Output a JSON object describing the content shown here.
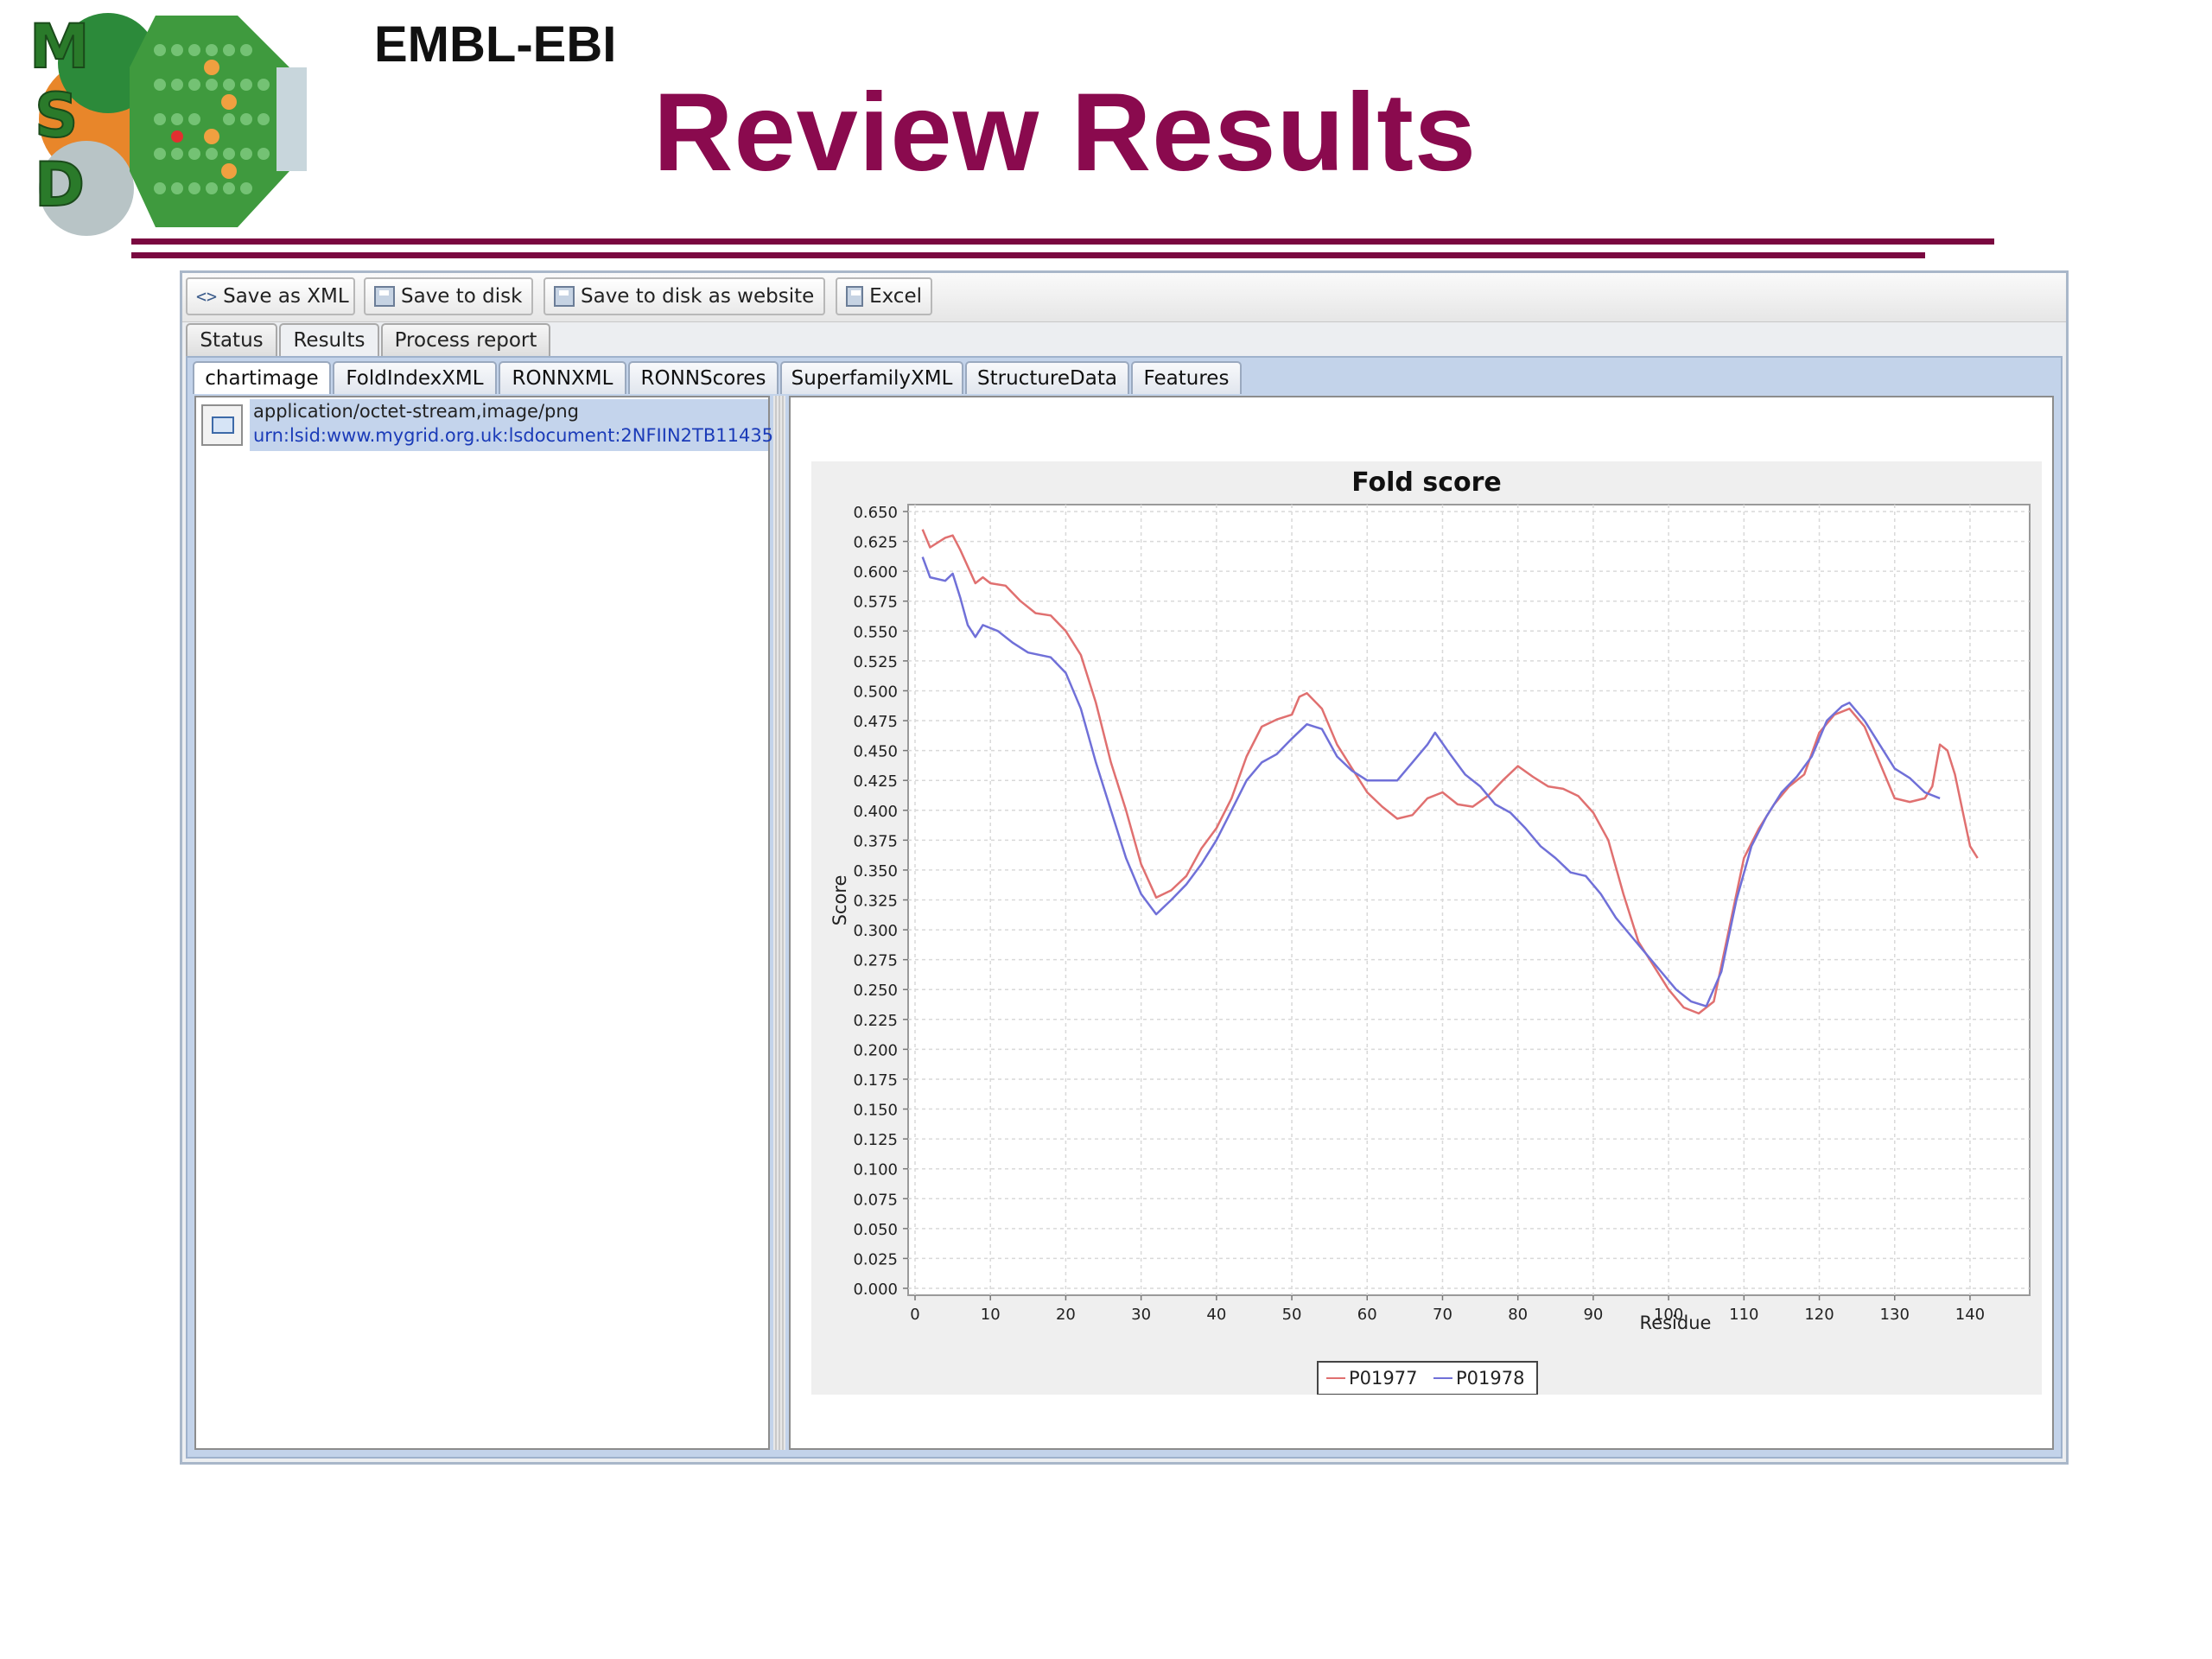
{
  "header": {
    "org": "EMBL-EBI",
    "title": "Review Results",
    "logo_text": "MSD",
    "title_color": "#8a0a4e"
  },
  "toolbar": {
    "save_xml": "Save as XML",
    "save_disk": "Save to disk",
    "save_website": "Save to disk as website",
    "excel": "Excel"
  },
  "tabs": {
    "main": [
      "Status",
      "Results",
      "Process report"
    ],
    "active_main": "Results",
    "sub": [
      "chartimage",
      "FoldIndexXML",
      "RONNXML",
      "RONNScores",
      "SuperfamilyXML",
      "StructureData",
      "Features"
    ],
    "active_sub": "chartimage"
  },
  "result_item": {
    "mime": "application/octet-stream,image/png",
    "urn": "urn:lsid:www.mygrid.org.uk:lsdocument:2NFIIN2TB11435"
  },
  "chart_data": {
    "type": "line",
    "title": "Fold score",
    "xlabel": "Residue",
    "ylabel": "Score",
    "xlim": [
      0,
      147
    ],
    "ylim": [
      0,
      0.65
    ],
    "xticks": [
      0,
      10,
      20,
      30,
      40,
      50,
      60,
      70,
      80,
      90,
      100,
      110,
      120,
      130,
      140
    ],
    "yticks": [
      0.0,
      0.025,
      0.05,
      0.075,
      0.1,
      0.125,
      0.15,
      0.175,
      0.2,
      0.225,
      0.25,
      0.275,
      0.3,
      0.325,
      0.35,
      0.375,
      0.4,
      0.425,
      0.45,
      0.475,
      0.5,
      0.525,
      0.55,
      0.575,
      0.6,
      0.625,
      0.65
    ],
    "grid": true,
    "legend": "bottom-center",
    "series": [
      {
        "name": "P01977",
        "color": "#e07070",
        "points": [
          [
            1,
            0.635
          ],
          [
            2,
            0.62
          ],
          [
            4,
            0.628
          ],
          [
            5,
            0.63
          ],
          [
            6,
            0.618
          ],
          [
            8,
            0.59
          ],
          [
            9,
            0.595
          ],
          [
            10,
            0.59
          ],
          [
            12,
            0.588
          ],
          [
            14,
            0.575
          ],
          [
            16,
            0.565
          ],
          [
            18,
            0.563
          ],
          [
            20,
            0.55
          ],
          [
            22,
            0.53
          ],
          [
            24,
            0.49
          ],
          [
            26,
            0.44
          ],
          [
            28,
            0.4
          ],
          [
            30,
            0.355
          ],
          [
            32,
            0.327
          ],
          [
            34,
            0.333
          ],
          [
            36,
            0.345
          ],
          [
            38,
            0.368
          ],
          [
            40,
            0.385
          ],
          [
            42,
            0.41
          ],
          [
            44,
            0.445
          ],
          [
            46,
            0.47
          ],
          [
            48,
            0.476
          ],
          [
            50,
            0.48
          ],
          [
            51,
            0.495
          ],
          [
            52,
            0.498
          ],
          [
            54,
            0.485
          ],
          [
            56,
            0.455
          ],
          [
            58,
            0.435
          ],
          [
            60,
            0.415
          ],
          [
            62,
            0.403
          ],
          [
            64,
            0.393
          ],
          [
            66,
            0.396
          ],
          [
            68,
            0.41
          ],
          [
            70,
            0.415
          ],
          [
            72,
            0.405
          ],
          [
            74,
            0.403
          ],
          [
            76,
            0.412
          ],
          [
            78,
            0.425
          ],
          [
            80,
            0.437
          ],
          [
            82,
            0.428
          ],
          [
            84,
            0.42
          ],
          [
            86,
            0.418
          ],
          [
            88,
            0.412
          ],
          [
            90,
            0.398
          ],
          [
            92,
            0.375
          ],
          [
            94,
            0.33
          ],
          [
            96,
            0.29
          ],
          [
            98,
            0.27
          ],
          [
            100,
            0.25
          ],
          [
            102,
            0.235
          ],
          [
            104,
            0.23
          ],
          [
            106,
            0.24
          ],
          [
            108,
            0.3
          ],
          [
            110,
            0.36
          ],
          [
            112,
            0.385
          ],
          [
            114,
            0.405
          ],
          [
            116,
            0.42
          ],
          [
            118,
            0.43
          ],
          [
            120,
            0.465
          ],
          [
            122,
            0.48
          ],
          [
            124,
            0.485
          ],
          [
            126,
            0.47
          ],
          [
            128,
            0.44
          ],
          [
            130,
            0.41
          ],
          [
            132,
            0.407
          ],
          [
            134,
            0.41
          ],
          [
            135,
            0.42
          ],
          [
            136,
            0.455
          ],
          [
            137,
            0.45
          ],
          [
            138,
            0.43
          ],
          [
            139,
            0.4
          ],
          [
            140,
            0.37
          ],
          [
            141,
            0.36
          ]
        ]
      },
      {
        "name": "P01978",
        "color": "#7070d8",
        "points": [
          [
            1,
            0.612
          ],
          [
            2,
            0.595
          ],
          [
            4,
            0.592
          ],
          [
            5,
            0.598
          ],
          [
            6,
            0.578
          ],
          [
            7,
            0.555
          ],
          [
            8,
            0.545
          ],
          [
            9,
            0.555
          ],
          [
            11,
            0.55
          ],
          [
            13,
            0.54
          ],
          [
            15,
            0.532
          ],
          [
            18,
            0.528
          ],
          [
            20,
            0.515
          ],
          [
            22,
            0.485
          ],
          [
            24,
            0.44
          ],
          [
            26,
            0.4
          ],
          [
            28,
            0.36
          ],
          [
            30,
            0.33
          ],
          [
            32,
            0.313
          ],
          [
            34,
            0.325
          ],
          [
            36,
            0.338
          ],
          [
            38,
            0.355
          ],
          [
            40,
            0.375
          ],
          [
            42,
            0.4
          ],
          [
            44,
            0.425
          ],
          [
            46,
            0.44
          ],
          [
            48,
            0.447
          ],
          [
            50,
            0.46
          ],
          [
            52,
            0.472
          ],
          [
            54,
            0.468
          ],
          [
            56,
            0.445
          ],
          [
            58,
            0.433
          ],
          [
            60,
            0.425
          ],
          [
            62,
            0.425
          ],
          [
            64,
            0.425
          ],
          [
            66,
            0.44
          ],
          [
            68,
            0.455
          ],
          [
            69,
            0.465
          ],
          [
            71,
            0.447
          ],
          [
            73,
            0.43
          ],
          [
            75,
            0.42
          ],
          [
            77,
            0.405
          ],
          [
            79,
            0.398
          ],
          [
            81,
            0.385
          ],
          [
            83,
            0.37
          ],
          [
            85,
            0.36
          ],
          [
            87,
            0.348
          ],
          [
            89,
            0.345
          ],
          [
            91,
            0.33
          ],
          [
            93,
            0.31
          ],
          [
            95,
            0.295
          ],
          [
            97,
            0.28
          ],
          [
            99,
            0.265
          ],
          [
            101,
            0.25
          ],
          [
            103,
            0.24
          ],
          [
            105,
            0.236
          ],
          [
            107,
            0.265
          ],
          [
            109,
            0.325
          ],
          [
            111,
            0.37
          ],
          [
            113,
            0.395
          ],
          [
            115,
            0.415
          ],
          [
            117,
            0.428
          ],
          [
            119,
            0.445
          ],
          [
            121,
            0.475
          ],
          [
            123,
            0.487
          ],
          [
            124,
            0.49
          ],
          [
            126,
            0.475
          ],
          [
            128,
            0.455
          ],
          [
            130,
            0.435
          ],
          [
            132,
            0.427
          ],
          [
            134,
            0.415
          ],
          [
            136,
            0.41
          ]
        ]
      }
    ]
  }
}
